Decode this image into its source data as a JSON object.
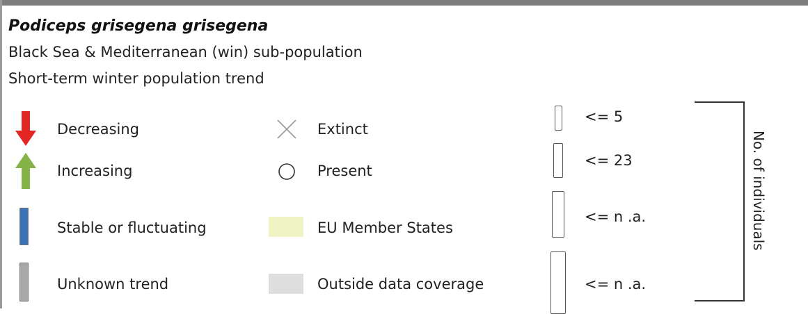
{
  "header": {
    "species": "Podiceps grisegena grisegena",
    "subpopulation": "Black Sea & Mediterranean (win) sub-population",
    "trend_title": "Short-term winter population trend"
  },
  "legend": {
    "trends": [
      {
        "label": "Decreasing",
        "icon": "down-arrow-icon",
        "color": "#e32624"
      },
      {
        "label": "Increasing",
        "icon": "up-arrow-icon",
        "color": "#86b347"
      },
      {
        "label": "Stable or fluctuating",
        "icon": "stable-bar-icon",
        "color": "#3c72b8"
      },
      {
        "label": "Unknown trend",
        "icon": "unknown-bar-icon",
        "color": "#a8a8a8"
      }
    ],
    "status": [
      {
        "label": "Extinct",
        "icon": "cross-icon"
      },
      {
        "label": "Present",
        "icon": "circle-icon"
      },
      {
        "label": "EU Member States",
        "icon": "eu-swatch",
        "color": "#f0f4c4"
      },
      {
        "label": "Outside data coverage",
        "icon": "outside-swatch",
        "color": "#dedede"
      }
    ],
    "size_classes": [
      {
        "label": "<= 5"
      },
      {
        "label": "<= 23"
      },
      {
        "label": "<= n .a."
      },
      {
        "label": "<= n .a."
      }
    ],
    "size_axis_label": "No. of individuals"
  }
}
